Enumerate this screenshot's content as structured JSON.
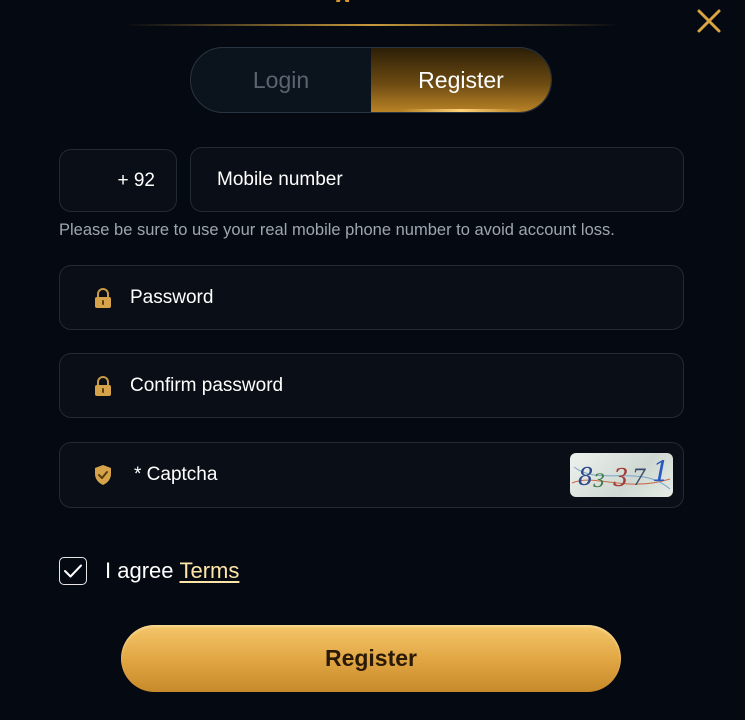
{
  "header": {
    "title_partial": "g"
  },
  "tabs": [
    {
      "label": "Login",
      "active": false
    },
    {
      "label": "Register",
      "active": true
    }
  ],
  "phone": {
    "country_code": "+ 92",
    "placeholder": "Mobile number",
    "hint": "Please be sure to use your real mobile phone number to avoid account loss."
  },
  "password": {
    "placeholder": "Password",
    "icon": "lock-icon"
  },
  "confirm_password": {
    "placeholder": "Confirm password",
    "icon": "lock-icon"
  },
  "captcha": {
    "placeholder": "* Captcha",
    "icon": "shield-icon",
    "image_code": "83371"
  },
  "agree": {
    "checked": true,
    "text": "I agree",
    "link": "Terms"
  },
  "submit": {
    "label": "Register"
  },
  "colors": {
    "background": "#050912",
    "accent_gold": "#e2a745",
    "field_bg": "#0a0f17",
    "field_border": "#222a34",
    "hint": "#9ea6b0",
    "link": "#ffe6a8"
  }
}
